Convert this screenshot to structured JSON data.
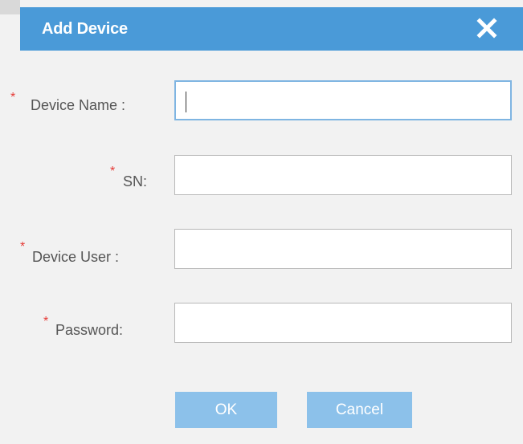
{
  "dialog": {
    "title": "Add Device",
    "close_icon": "close-icon"
  },
  "form": {
    "required_marker": "*",
    "device_name": {
      "label": "Device Name :",
      "value": "",
      "placeholder": ""
    },
    "sn": {
      "label": "SN:",
      "value": "",
      "placeholder": ""
    },
    "device_user": {
      "label": "Device User :",
      "value": "",
      "placeholder": ""
    },
    "password": {
      "label": "Password:",
      "value": "",
      "placeholder": ""
    }
  },
  "buttons": {
    "ok_label": "OK",
    "cancel_label": "Cancel"
  },
  "colors": {
    "titlebar": "#4a9ad8",
    "button": "#8cc1ea",
    "required": "#e53935",
    "focus_border": "#7fb5e2"
  }
}
